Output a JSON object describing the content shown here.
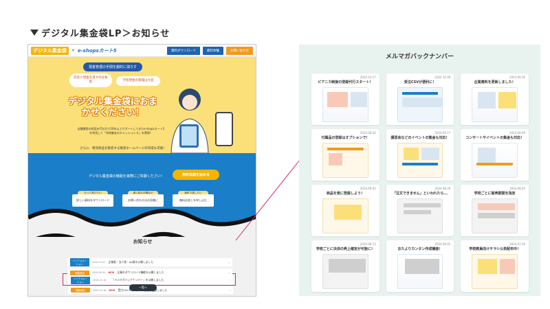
{
  "heading": "デジタル集金袋LP＞お知らせ",
  "lp": {
    "logo_main": "デジタル集金袋",
    "logo_x": "×",
    "logo_partner": "e-shopsカート5",
    "header_buttons": [
      "資料ダウンロード",
      "無料体験",
      "お問い合わせ"
    ],
    "worry_label": "現金管理の手間を劇的に減らす",
    "bubble_1": "先生に現金を渡すのは負担",
    "bubble_2": "学校現金の管理は大変",
    "hero_title": "デジタル集金袋におまかせください！",
    "hero_desc": "店舗運営の知見をITの力で20年以上サポートしてきたe-shopsカート5を利用して「学校集金のキャッシュレス」を実現！",
    "hero_desc2": "さらに、物流商品を販売する販売ホームページの作成も可能！",
    "cta_text": "デジタル集金袋の機能を実際にご体験ください！",
    "cta_button": "無料体験を始める",
    "sub_items": [
      {
        "tag": "もっと知りたい",
        "label": "詳しい資料をダウンロード"
      },
      {
        "tag": "導入前のお問合せ",
        "label": "お問い合わせはお気軽に"
      },
      {
        "tag": "無料で試したい",
        "label": "無料お試しを申し込む"
      }
    ],
    "news_title": "お知らせ",
    "news_rows": [
      {
        "tag": "インフォメーション",
        "tag_color": "blue",
        "date": "2024.10.18",
        "new": "",
        "text": "「メルマガバックナンバー」を公開しました"
      },
      {
        "tag": "機能追加",
        "tag_color": "orange",
        "date": "2024.10.18",
        "new": "NEW",
        "text": "受付CSVエクスポート機能を追加しました"
      },
      {
        "tag": "インフォメーション",
        "tag_color": "blue",
        "date": "2024.10.01",
        "new": "",
        "text": "企業版・法人版・Ap版を公開しました"
      },
      {
        "tag": "機能追加",
        "tag_color": "orange",
        "date": "2024.09.30",
        "new": "NEW",
        "text": "企業のダウンロード機能を公開しました"
      }
    ],
    "list_button": "一覧へ"
  },
  "backnumber": {
    "title": "メルマガバックナンバー",
    "cards": [
      {
        "date": "2024.10.17",
        "title": "ピアニカ斡旋の登録代行スタート！"
      },
      {
        "date": "2024.10.09",
        "title": "受注CSVが便利に！"
      },
      {
        "date": "2024.09.30",
        "title": "企業資料を更新しました！"
      },
      {
        "date": "2024.09.24",
        "title": "付属品の登録はオプションで！"
      },
      {
        "date": "2024.09.17",
        "title": "講習会などのイベントの集金も対応！"
      },
      {
        "date": "2024.09.09",
        "title": "コンサートやイベントの集金も対応！"
      },
      {
        "date": "2024.09.02",
        "title": "商品を楽に登録しよう！"
      },
      {
        "date": "2024.08.26",
        "title": "「注文できません」といわれたら..."
      },
      {
        "date": "2024.08.20",
        "title": "学校ごとに販売期間を指定"
      },
      {
        "date": "2024.08.13",
        "title": "学校ごとに決済の売上確定が可能に！"
      },
      {
        "date": "2024.08.01",
        "title": "おたよりカンタン作成機能！"
      },
      {
        "date": "2024.07.29",
        "title": "学校教員向けチラシ公表配布中！"
      }
    ]
  },
  "colors": {
    "yellow": "#fbe07a",
    "blue": "#1a7fc8",
    "orange": "#f29a1e",
    "highlight": "#d02676",
    "backnumber_bg": "#e8f2ef"
  }
}
